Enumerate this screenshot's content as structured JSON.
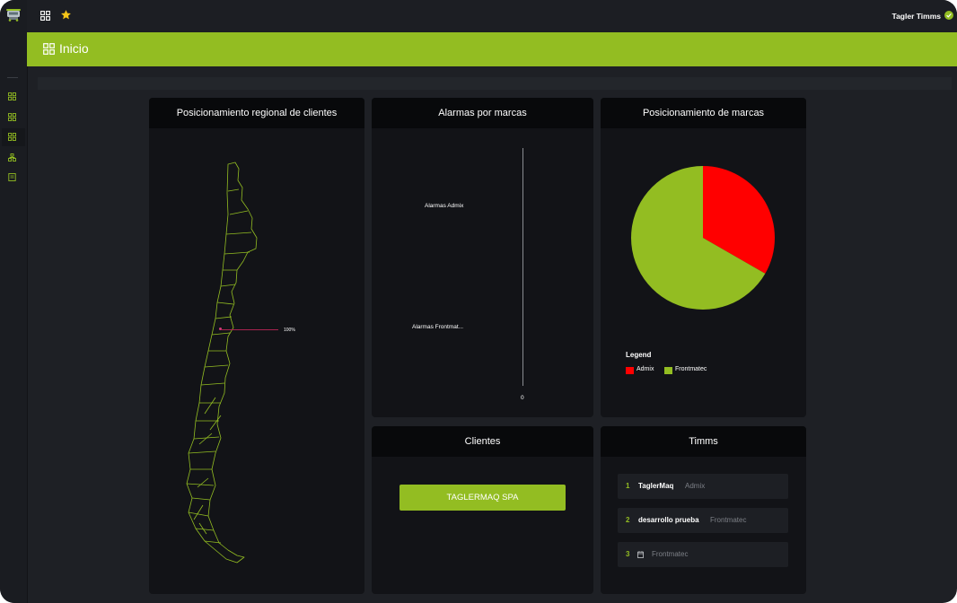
{
  "header": {
    "user_name": "Tagler Timms",
    "page_title": "Inicio"
  },
  "theme": {
    "accent": "#93bd22",
    "background": "#1e2025",
    "card": "#121317",
    "card_header": "#08090b"
  },
  "sidebar": {
    "icons": [
      "logo-icon",
      "dashboard-icon",
      "dashboard-icon",
      "dashboard-icon",
      "hierarchy-icon",
      "document-icon"
    ]
  },
  "cards": {
    "regional": {
      "title": "Posicionamiento regional de clientes",
      "marker_label": "100%",
      "marker_value": 100
    },
    "alarms": {
      "title": "Alarmas por marcas",
      "bars": [
        {
          "label": "Alarmas Admix",
          "value": 0
        },
        {
          "label": "Alarmas Frontmat...",
          "value": 0
        }
      ],
      "axis_zero": "0"
    },
    "brands": {
      "title": "Posicionamiento de marcas",
      "legend_title": "Legend"
    },
    "clients": {
      "title": "Clientes",
      "button_label": "TAGLERMAQ SPA"
    },
    "timms": {
      "title": "Timms",
      "items": [
        {
          "num": "1",
          "name": "TaglerMaq",
          "brand": "Admix"
        },
        {
          "num": "2",
          "name": "desarrollo prueba",
          "brand": "Frontmatec"
        },
        {
          "num": "3",
          "name": "",
          "brand": "Frontmatec"
        }
      ]
    }
  },
  "chart_data": {
    "type": "pie",
    "title": "Posicionamiento de marcas",
    "slices": [
      {
        "name": "Admix",
        "value": 33.3,
        "color": "#ff0000"
      },
      {
        "name": "Frontmatec",
        "value": 66.7,
        "color": "#93bd22"
      }
    ],
    "legend": "bottom-left"
  }
}
